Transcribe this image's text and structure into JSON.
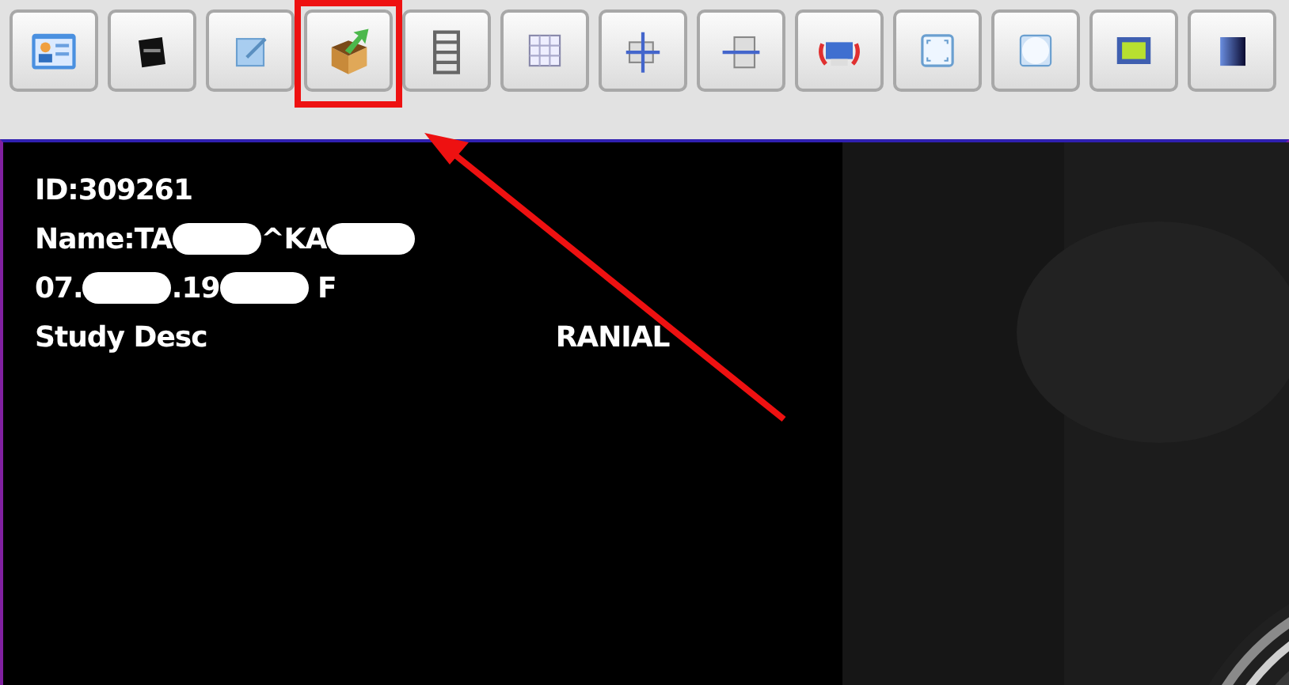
{
  "toolbar": {
    "buttons": [
      {
        "highlighted": false
      },
      {
        "highlighted": false
      },
      {
        "highlighted": false
      },
      {
        "highlighted": true
      },
      {
        "highlighted": false
      },
      {
        "highlighted": false
      },
      {
        "highlighted": false
      },
      {
        "highlighted": false
      },
      {
        "highlighted": false
      },
      {
        "highlighted": false
      },
      {
        "highlighted": false
      },
      {
        "highlighted": false
      },
      {
        "highlighted": false
      }
    ]
  },
  "viewer": {
    "overlay_lines": [
      [
        {
          "kind": "text",
          "text": "ID:309261"
        }
      ],
      [
        {
          "kind": "text",
          "text": "Name:TA"
        },
        {
          "kind": "redacted"
        },
        {
          "kind": "text",
          "text": "^KA"
        },
        {
          "kind": "redacted"
        }
      ],
      [
        {
          "kind": "text",
          "text": "07."
        },
        {
          "kind": "redacted"
        },
        {
          "kind": "text",
          "text": ".19"
        },
        {
          "kind": "redacted"
        },
        {
          "kind": "text",
          "text": " F"
        }
      ],
      [
        {
          "kind": "text",
          "text": "Study Desc"
        },
        {
          "kind": "gap"
        },
        {
          "kind": "text",
          "text": "RANIAL"
        }
      ]
    ],
    "image": {
      "kind": "picture"
    }
  }
}
